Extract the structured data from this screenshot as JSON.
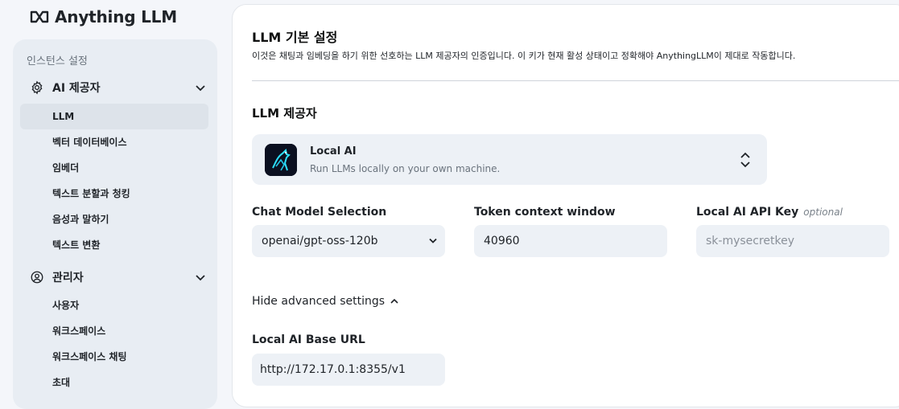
{
  "app": {
    "logo_text": "Anything LLM"
  },
  "sidebar": {
    "section_label": "인스턴스 설정",
    "groups": [
      {
        "label": "AI 제공자",
        "icon": "gear-icon",
        "items": [
          "LLM",
          "벡터 데이터베이스",
          "임베더",
          "텍스트 분할과 청킹",
          "음성과 말하기",
          "텍스트 변환"
        ]
      },
      {
        "label": "관리자",
        "icon": "user-gear-icon",
        "items": [
          "사용자",
          "워크스페이스",
          "워크스페이스 채팅",
          "초대"
        ]
      }
    ],
    "active_item": "LLM"
  },
  "main": {
    "title": "LLM 기본 설정",
    "description": "이것은 채팅과 임베딩을 하기 위한 선호하는 LLM 제공자의 인증입니다. 이 키가 현재 활성 상태이고 정확해야 AnythingLLM이 제대로 작동합니다.",
    "provider_label": "LLM 제공자",
    "provider": {
      "name": "Local AI",
      "subtitle": "Run LLMs locally on your own machine."
    },
    "fields": {
      "chat_model": {
        "label": "Chat Model Selection",
        "value": "openai/gpt-oss-120b"
      },
      "token_window": {
        "label": "Token context window",
        "value": "40960"
      },
      "api_key": {
        "label": "Local AI API Key",
        "optional": "optional",
        "placeholder": "sk-mysecretkey"
      }
    },
    "advanced_toggle": "Hide advanced settings",
    "base_url": {
      "label": "Local AI Base URL",
      "value": "http://172.17.0.1:8355/v1"
    }
  }
}
